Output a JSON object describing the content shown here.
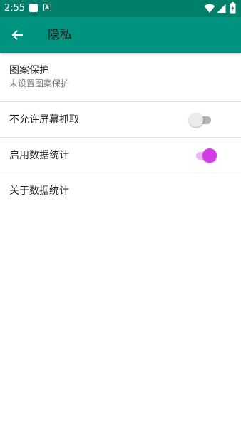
{
  "status_bar": {
    "time": "2:55",
    "icons": [
      "notification-square-icon",
      "notification-a-icon",
      "wifi-icon",
      "signal-icon",
      "battery-icon"
    ]
  },
  "app_bar": {
    "title": "隐私",
    "back_icon": "arrow-back-icon"
  },
  "settings": [
    {
      "title": "图案保护",
      "summary": "未设置图案保护"
    },
    {
      "title": "不允许屏幕抓取",
      "switch": false
    },
    {
      "title": "启用数据统计",
      "switch": true
    },
    {
      "title": "关于数据统计"
    }
  ],
  "colors": {
    "status_bar": "#00806a",
    "app_bar": "#009480",
    "switch_on_thumb": "#d33de6",
    "switch_on_track": "#eeb6f3",
    "switch_off_thumb": "#ececec",
    "switch_off_track": "#b4b4b4"
  }
}
